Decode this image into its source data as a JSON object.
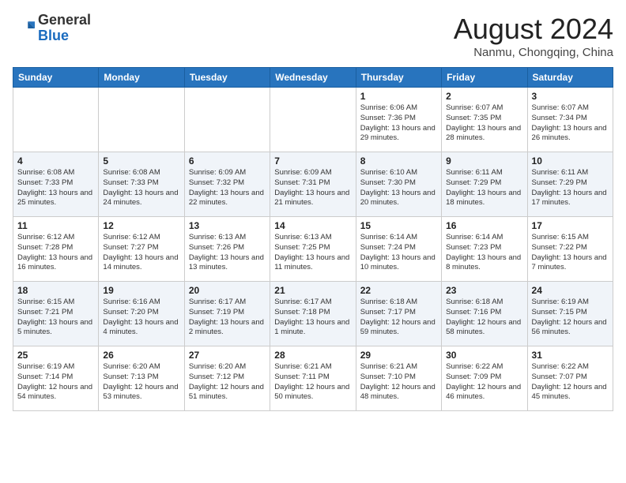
{
  "header": {
    "logo_general": "General",
    "logo_blue": "Blue",
    "month": "August 2024",
    "location": "Nanmu, Chongqing, China"
  },
  "days_of_week": [
    "Sunday",
    "Monday",
    "Tuesday",
    "Wednesday",
    "Thursday",
    "Friday",
    "Saturday"
  ],
  "weeks": [
    [
      {
        "day": "",
        "info": ""
      },
      {
        "day": "",
        "info": ""
      },
      {
        "day": "",
        "info": ""
      },
      {
        "day": "",
        "info": ""
      },
      {
        "day": "1",
        "info": "Sunrise: 6:06 AM\nSunset: 7:36 PM\nDaylight: 13 hours\nand 29 minutes."
      },
      {
        "day": "2",
        "info": "Sunrise: 6:07 AM\nSunset: 7:35 PM\nDaylight: 13 hours\nand 28 minutes."
      },
      {
        "day": "3",
        "info": "Sunrise: 6:07 AM\nSunset: 7:34 PM\nDaylight: 13 hours\nand 26 minutes."
      }
    ],
    [
      {
        "day": "4",
        "info": "Sunrise: 6:08 AM\nSunset: 7:33 PM\nDaylight: 13 hours\nand 25 minutes."
      },
      {
        "day": "5",
        "info": "Sunrise: 6:08 AM\nSunset: 7:33 PM\nDaylight: 13 hours\nand 24 minutes."
      },
      {
        "day": "6",
        "info": "Sunrise: 6:09 AM\nSunset: 7:32 PM\nDaylight: 13 hours\nand 22 minutes."
      },
      {
        "day": "7",
        "info": "Sunrise: 6:09 AM\nSunset: 7:31 PM\nDaylight: 13 hours\nand 21 minutes."
      },
      {
        "day": "8",
        "info": "Sunrise: 6:10 AM\nSunset: 7:30 PM\nDaylight: 13 hours\nand 20 minutes."
      },
      {
        "day": "9",
        "info": "Sunrise: 6:11 AM\nSunset: 7:29 PM\nDaylight: 13 hours\nand 18 minutes."
      },
      {
        "day": "10",
        "info": "Sunrise: 6:11 AM\nSunset: 7:29 PM\nDaylight: 13 hours\nand 17 minutes."
      }
    ],
    [
      {
        "day": "11",
        "info": "Sunrise: 6:12 AM\nSunset: 7:28 PM\nDaylight: 13 hours\nand 16 minutes."
      },
      {
        "day": "12",
        "info": "Sunrise: 6:12 AM\nSunset: 7:27 PM\nDaylight: 13 hours\nand 14 minutes."
      },
      {
        "day": "13",
        "info": "Sunrise: 6:13 AM\nSunset: 7:26 PM\nDaylight: 13 hours\nand 13 minutes."
      },
      {
        "day": "14",
        "info": "Sunrise: 6:13 AM\nSunset: 7:25 PM\nDaylight: 13 hours\nand 11 minutes."
      },
      {
        "day": "15",
        "info": "Sunrise: 6:14 AM\nSunset: 7:24 PM\nDaylight: 13 hours\nand 10 minutes."
      },
      {
        "day": "16",
        "info": "Sunrise: 6:14 AM\nSunset: 7:23 PM\nDaylight: 13 hours\nand 8 minutes."
      },
      {
        "day": "17",
        "info": "Sunrise: 6:15 AM\nSunset: 7:22 PM\nDaylight: 13 hours\nand 7 minutes."
      }
    ],
    [
      {
        "day": "18",
        "info": "Sunrise: 6:15 AM\nSunset: 7:21 PM\nDaylight: 13 hours\nand 5 minutes."
      },
      {
        "day": "19",
        "info": "Sunrise: 6:16 AM\nSunset: 7:20 PM\nDaylight: 13 hours\nand 4 minutes."
      },
      {
        "day": "20",
        "info": "Sunrise: 6:17 AM\nSunset: 7:19 PM\nDaylight: 13 hours\nand 2 minutes."
      },
      {
        "day": "21",
        "info": "Sunrise: 6:17 AM\nSunset: 7:18 PM\nDaylight: 13 hours\nand 1 minute."
      },
      {
        "day": "22",
        "info": "Sunrise: 6:18 AM\nSunset: 7:17 PM\nDaylight: 12 hours\nand 59 minutes."
      },
      {
        "day": "23",
        "info": "Sunrise: 6:18 AM\nSunset: 7:16 PM\nDaylight: 12 hours\nand 58 minutes."
      },
      {
        "day": "24",
        "info": "Sunrise: 6:19 AM\nSunset: 7:15 PM\nDaylight: 12 hours\nand 56 minutes."
      }
    ],
    [
      {
        "day": "25",
        "info": "Sunrise: 6:19 AM\nSunset: 7:14 PM\nDaylight: 12 hours\nand 54 minutes."
      },
      {
        "day": "26",
        "info": "Sunrise: 6:20 AM\nSunset: 7:13 PM\nDaylight: 12 hours\nand 53 minutes."
      },
      {
        "day": "27",
        "info": "Sunrise: 6:20 AM\nSunset: 7:12 PM\nDaylight: 12 hours\nand 51 minutes."
      },
      {
        "day": "28",
        "info": "Sunrise: 6:21 AM\nSunset: 7:11 PM\nDaylight: 12 hours\nand 50 minutes."
      },
      {
        "day": "29",
        "info": "Sunrise: 6:21 AM\nSunset: 7:10 PM\nDaylight: 12 hours\nand 48 minutes."
      },
      {
        "day": "30",
        "info": "Sunrise: 6:22 AM\nSunset: 7:09 PM\nDaylight: 12 hours\nand 46 minutes."
      },
      {
        "day": "31",
        "info": "Sunrise: 6:22 AM\nSunset: 7:07 PM\nDaylight: 12 hours\nand 45 minutes."
      }
    ]
  ]
}
